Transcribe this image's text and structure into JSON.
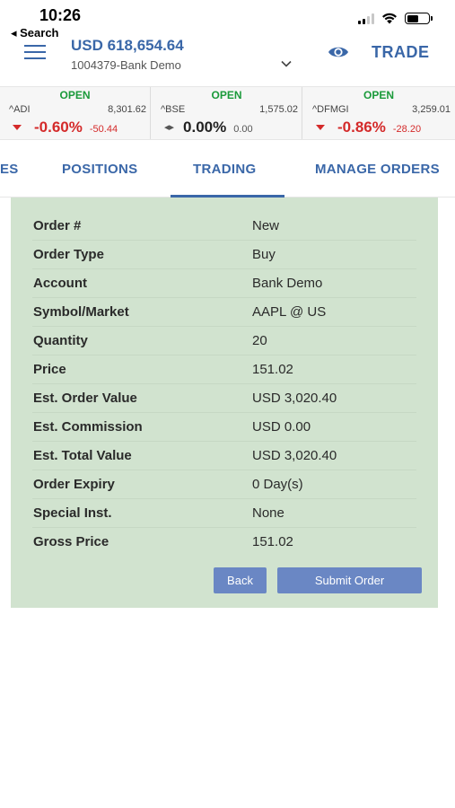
{
  "status_bar": {
    "time": "10:26",
    "back_label": "◂ Search"
  },
  "header": {
    "balance": "USD 618,654.64",
    "account": "1004379-Bank Demo",
    "trade_label": "TRADE"
  },
  "tickers": [
    {
      "status": "OPEN",
      "symbol": "^ADI",
      "last": "8,301.62",
      "pct": "-0.60%",
      "change": "-50.44",
      "direction": "down"
    },
    {
      "status": "OPEN",
      "symbol": "^BSE",
      "last": "1,575.02",
      "pct": "0.00%",
      "change": "0.00",
      "direction": "flat"
    },
    {
      "status": "OPEN",
      "symbol": "^DFMGI",
      "last": "3,259.01",
      "pct": "-0.86%",
      "change": "-28.20",
      "direction": "down"
    }
  ],
  "tabs": [
    {
      "label": "ES"
    },
    {
      "label": "POSITIONS"
    },
    {
      "label": "TRADING",
      "active": true
    },
    {
      "label": "MANAGE ORDERS"
    }
  ],
  "order": {
    "rows": [
      {
        "label": "Order #",
        "value": "New"
      },
      {
        "label": "Order Type",
        "value": "Buy"
      },
      {
        "label": "Account",
        "value": "Bank Demo"
      },
      {
        "label": "Symbol/Market",
        "value": "AAPL @ US"
      },
      {
        "label": "Quantity",
        "value": "20"
      },
      {
        "label": "Price",
        "value": "151.02"
      },
      {
        "label": "Est. Order Value",
        "value": "USD 3,020.40"
      },
      {
        "label": "Est. Commission",
        "value": "USD 0.00"
      },
      {
        "label": "Est. Total Value",
        "value": "USD 3,020.40"
      },
      {
        "label": "Order Expiry",
        "value": "0 Day(s)"
      },
      {
        "label": "Special Inst.",
        "value": "None"
      },
      {
        "label": "Gross Price",
        "value": "151.02"
      }
    ],
    "back_label": "Back",
    "submit_label": "Submit Order"
  },
  "colors": {
    "accent": "#3a67a8",
    "open": "#1a9a3a",
    "negative": "#d42a2a",
    "panel_bg": "#d1e3cf",
    "button_bg": "#6a87c4"
  }
}
